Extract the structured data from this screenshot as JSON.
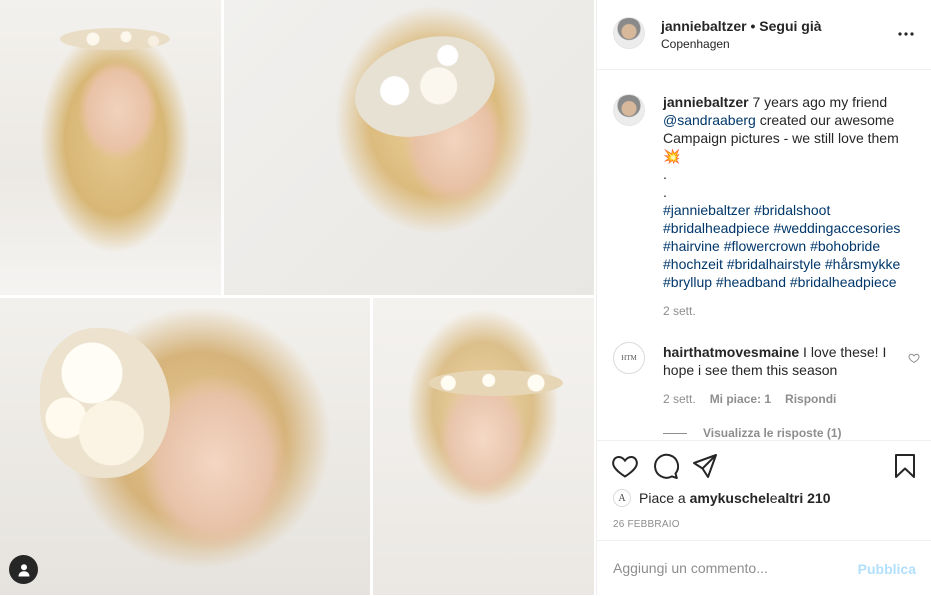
{
  "post": {
    "photos": [
      {
        "alt": "model-with-floral-headband"
      },
      {
        "alt": "model-with-jeweled-hairpiece"
      },
      {
        "alt": "model-with-flower-hairpiece"
      },
      {
        "alt": "model-with-leaf-crown"
      }
    ]
  },
  "header": {
    "username": "janniebaltzer",
    "separator": " • ",
    "follow_status": "Segui già",
    "location": "Copenhagen",
    "more_icon": "more-horizontal-icon"
  },
  "caption": {
    "username": "janniebaltzer",
    "text_before_mention": " 7 years ago my friend ",
    "mention": "@sandraaberg",
    "text_after_mention": " created our awesome Campaign pictures - we still love them ",
    "emoji": "💥",
    "dot1": ".",
    "dot2": ".",
    "hashtags": "#janniebaltzer #bridalshoot #bridalheadpiece #weddingaccesories #hairvine #flowercrown #bohobride #hochzeit #bridalhairstyle #hårsmykke #bryllup #headband #bridalheadpiece",
    "time": "2 sett."
  },
  "comment": {
    "avatar_text": "HTM",
    "username": "hairthatmovesmaine",
    "text": " I love these! I hope i see them this season",
    "time": "2 sett.",
    "likes": "Mi piace: 1",
    "reply": "Rispondi",
    "view_replies": "Visualizza le risposte (1)"
  },
  "actions": {
    "like_icon": "heart-icon",
    "comment_icon": "comment-icon",
    "share_icon": "send-icon",
    "save_icon": "bookmark-icon"
  },
  "likes": {
    "prefix": "Piace a ",
    "user": "amykuschel",
    "middle": " e ",
    "others": "altri 210",
    "avatar_text": "A"
  },
  "date": "26 febbraio",
  "comment_box": {
    "placeholder": "Aggiungi un commento...",
    "publish": "Pubblica"
  },
  "colors": {
    "link": "#00376b",
    "muted": "#8e8e8e",
    "publish_disabled": "#b2dffc"
  }
}
